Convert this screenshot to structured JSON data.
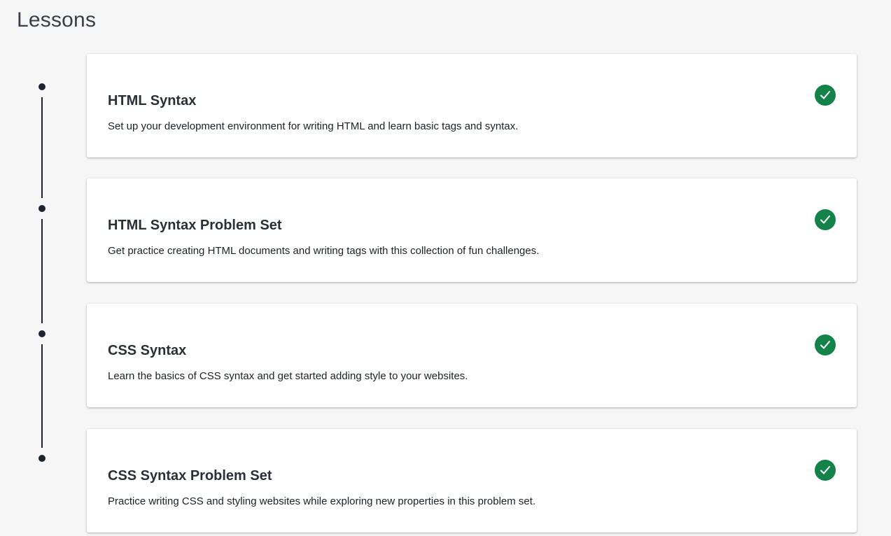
{
  "page": {
    "title": "Lessons"
  },
  "theme": {
    "accent_complete": "#13834a",
    "timeline_color": "#1e2330",
    "background": "#f6f6f6"
  },
  "lessons": [
    {
      "title": "HTML Syntax",
      "description": "Set up your development environment for writing HTML and learn basic tags and syntax.",
      "status_icon": "check-circle-icon"
    },
    {
      "title": "HTML Syntax Problem Set",
      "description": "Get practice creating HTML documents and writing tags with this collection of fun challenges.",
      "status_icon": "check-circle-icon"
    },
    {
      "title": "CSS Syntax",
      "description": "Learn the basics of CSS syntax and get started adding style to your websites.",
      "status_icon": "check-circle-icon"
    },
    {
      "title": "CSS Syntax Problem Set",
      "description": "Practice writing CSS and styling websites while exploring new properties in this problem set.",
      "status_icon": "check-circle-icon"
    }
  ]
}
